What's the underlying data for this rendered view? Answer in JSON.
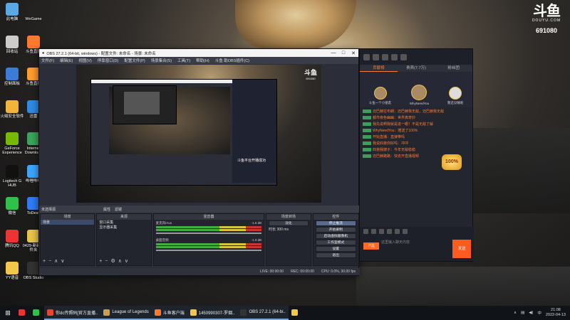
{
  "brand": {
    "logo_text": "斗鱼",
    "domain_text": "DOUYU.COM",
    "room_id": "691080"
  },
  "desktop_icons": [
    {
      "label": "此电脑",
      "color": "#5aa9e6"
    },
    {
      "label": "WeGame",
      "color": "#222"
    },
    {
      "label": "回收站",
      "color": "#ccc"
    },
    {
      "label": "斗鱼直播",
      "color": "#ff7a2f"
    },
    {
      "label": "控制面板",
      "color": "#3d7bd9"
    },
    {
      "label": "斗鱼直播",
      "color": "#ff9b2f"
    },
    {
      "label": "火绒安全软件",
      "color": "#f2b43a"
    },
    {
      "label": "迅雷",
      "color": "#2e8be6"
    },
    {
      "label": "GeForce Experience",
      "color": "#76b900"
    },
    {
      "label": "Internet Download",
      "color": "#3aa55c"
    },
    {
      "label": "Logitech G HUB",
      "color": "#111"
    },
    {
      "label": "哔哩哔哩",
      "color": "#3ea6ff"
    },
    {
      "label": "微信",
      "color": "#2ec24a"
    },
    {
      "label": "ToDesk",
      "color": "#2f7cf6"
    },
    {
      "label": "腾讯QQ",
      "color": "#e33"
    },
    {
      "label": "0429-新建文件夹",
      "color": "#e9c44a"
    },
    {
      "label": "YY语音",
      "color": "#f2c74a"
    },
    {
      "label": "OBS Studio",
      "color": "#333"
    }
  ],
  "obs": {
    "title": "OBS 27.2.1 (64-bit, windows) - 配置文件: 未命名 - 场景: 未命名",
    "menu": [
      "文件(F)",
      "编辑(E)",
      "视图(V)",
      "停靠窗口(D)",
      "配置文件(P)",
      "场景集合(S)",
      "工具(T)",
      "帮助(H)",
      "斗鱼 助OBS插件(C)"
    ],
    "window_controls": [
      "—",
      "□",
      "✕"
    ],
    "no_source_label": "未选择源",
    "property_buttons": [
      "属性",
      "滤镜"
    ],
    "preview_caption": "斗鱼平台开播成功",
    "docks": {
      "scenes": {
        "title": "场景",
        "items": [
          "场景"
        ]
      },
      "sources": {
        "title": "来源",
        "items": [
          "窗口采集",
          "显示器采集"
        ]
      },
      "mixer": {
        "title": "混音器",
        "channels": [
          {
            "name": "麦克风/Aux",
            "db": "-1.6 dB"
          },
          {
            "name": "桌面音频",
            "db": "-1.0 dB"
          }
        ]
      },
      "transitions": {
        "title": "场景转场",
        "mode": "淡化",
        "duration_label": "时长",
        "duration": "300 ms"
      },
      "controls": {
        "title": "控件",
        "buttons": [
          "停止推流",
          "开始录制",
          "启动虚拟摄像机",
          "工作室模式",
          "设置",
          "退出"
        ]
      }
    },
    "status": {
      "drop": "LIVE: 00:00:00",
      "rec": "REC: 00:00:00",
      "cpu": "CPU: 0.0%, 30.00 fps"
    }
  },
  "chat": {
    "tabs": [
      "贡献榜",
      "贵宾(7.7万)",
      "粉丝团"
    ],
    "top_ranks": [
      {
        "name": "斗鱼一个小朋友"
      },
      {
        "name": "WhyNeedYou"
      },
      {
        "name": "我还没睡呢"
      }
    ],
    "messages": [
      "迈巴赫拉布朗：迈巴赫我无敌，迈巴赫我无敌",
      "都市夜色幽幽：世界真奇妙",
      "我先说啊我就是进一眼！不是无敌了解",
      "WhyNeedYou：赠送了100%",
      "开始直播：直接带吗",
      "我说四弟你好吗：冲冲",
      "四弟我嫂子：今年无敌稳稳",
      "迈巴赫路路：快去开直播视频"
    ],
    "gift_text": "100%",
    "input_placeholder": "这里输入聊天内容",
    "send_label": "发送",
    "level_badge": "严选"
  },
  "taskbar": {
    "items": [
      {
        "label": "",
        "color": "#e33"
      },
      {
        "label": "",
        "color": "#2ec24a"
      },
      {
        "label": "你dc传照码[官方直播..",
        "color": "#ea4335"
      },
      {
        "label": "League of Legends",
        "color": "#c8a14a"
      },
      {
        "label": "斗鱼客户端",
        "color": "#ff7a2f"
      },
      {
        "label": "1450990307-罗烟..",
        "color": "#f2c74a"
      },
      {
        "label": "OBS 27.2.1 (64-bi..",
        "color": "#333"
      },
      {
        "label": "",
        "color": "#f2c74a"
      }
    ],
    "time": "21:08",
    "date": "2022-04-13",
    "lang": "中"
  }
}
